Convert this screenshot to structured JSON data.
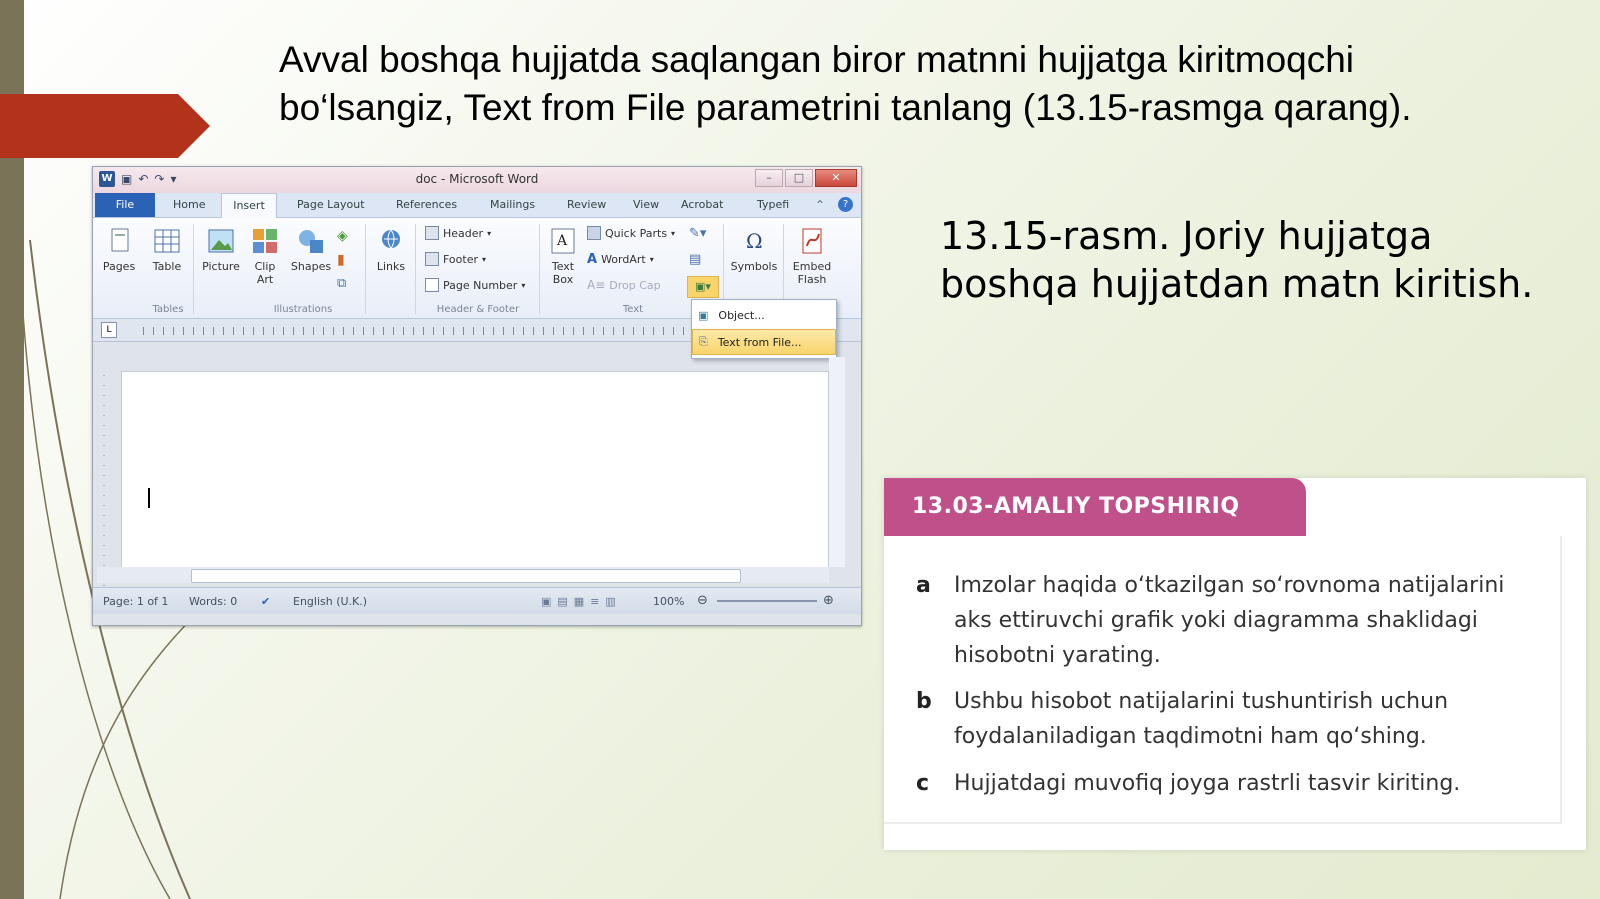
{
  "slide": {
    "title": "Avval boshqa hujjatda saqlangan biror matnni hujjatga kiritmoqchi bo‘lsangiz, Text from File parametrini tanlang (13.15-rasmga qarang).",
    "caption": "13.15-rasm. Joriy hujjatga boshqa hujjatdan matn kiritish."
  },
  "word": {
    "window_title": "doc - Microsoft Word",
    "window_controls": [
      "–",
      "□",
      "✕"
    ],
    "tabs": [
      "File",
      "Home",
      "Insert",
      "Page Layout",
      "References",
      "Mailings",
      "Review",
      "View",
      "Acrobat",
      "Typefi"
    ],
    "active_tab": "Insert",
    "ribbon": {
      "pages": "Pages",
      "table": "Table",
      "picture": "Picture",
      "clip_art": "Clip Art",
      "shapes": "Shapes",
      "links": "Links",
      "header": "Header",
      "footer": "Footer",
      "page_number": "Page Number",
      "text_box": "Text Box",
      "quick_parts": "Quick Parts",
      "wordart": "WordArt",
      "drop_cap": "Drop Cap",
      "symbols": "Symbols",
      "embed_flash": "Embed Flash",
      "groups": {
        "tables": "Tables",
        "illustrations": "Illustrations",
        "header_footer": "Header & Footer",
        "text": "Text"
      }
    },
    "dropdown": {
      "object": "Object...",
      "text_from_file": "Text from File..."
    },
    "status": {
      "page": "Page: 1 of 1",
      "words": "Words: 0",
      "language": "English (U.K.)",
      "zoom": "100%"
    }
  },
  "task": {
    "header": "13.03-AMALIY TOPSHIRIQ",
    "items": [
      {
        "letter": "a",
        "text": "Imzolar haqida o‘tkazilgan so‘rovnoma natijalarini aks ettiruvchi grafik yoki diagramma shaklidagi hisobotni yarating."
      },
      {
        "letter": "b",
        "text": "Ushbu hisobot natijalarini tushuntirish uchun foydalaniladigan taqdimotni ham qo‘shing."
      },
      {
        "letter": "c",
        "text": "Hujjatdagi muvofiq joyga rastrli tasvir kiriting."
      }
    ]
  },
  "colors": {
    "accent_arrow": "#b3321c",
    "task_header": "#c0508a",
    "left_bar": "#7a7357"
  }
}
